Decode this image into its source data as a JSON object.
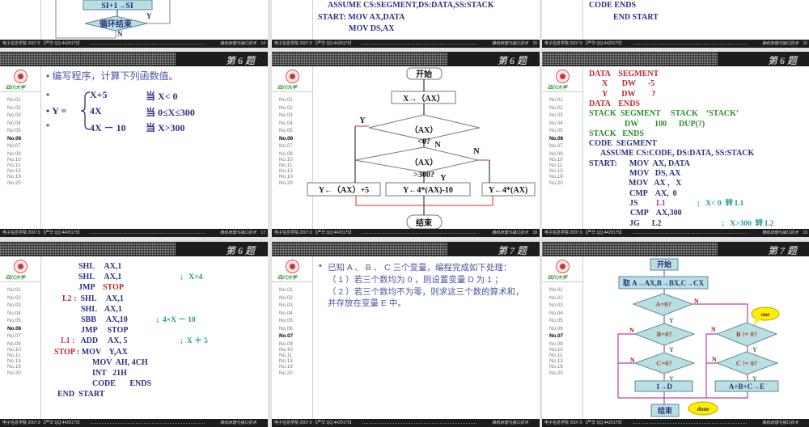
{
  "footer": {
    "left": "电子信息学院   2007.9 【严华  QQ:4429175】",
    "right": "微机原理与接口技术"
  },
  "logo_text": "四川大学",
  "nav": [
    "No.01",
    "No.02",
    "No.03",
    "No.04",
    "No.05",
    "No.06",
    "No.07",
    "No.09",
    "No.10",
    "No.11",
    "No.13",
    "No.19",
    "No.20"
  ],
  "colors": {
    "r": "#c0272d",
    "g": "#2e8b2e",
    "b": "#2b2f7f",
    "m": "#b03a9c",
    "t": "#1a9a9a",
    "accent_line": "#d0302a",
    "flow_line": "#c040a0",
    "flow_box": "#b9dfe2"
  },
  "slides": [
    {
      "page": "14",
      "flow": {
        "box": "SI+1→SI",
        "diamond": "循环结束",
        "y": "Y",
        "n": "N"
      }
    },
    {
      "page": "15",
      "code": [
        [
          [
            "ASSUME CS:SEGMENT,DS:DATA,SS:STACK",
            "b"
          ]
        ],
        [
          [
            "START: MOV AX,DATA",
            "b"
          ]
        ],
        [
          [
            "MOV DS,AX",
            "b"
          ]
        ]
      ]
    },
    {
      "page": "16",
      "code": [
        [
          [
            "CODE ENDS",
            "b"
          ]
        ],
        [
          [
            "END START",
            "b"
          ]
        ]
      ]
    },
    {
      "title": "第 6 题",
      "page": "17",
      "active": 5,
      "intro": "编写程序，计算下列函数值。",
      "y_label": "Y =",
      "cases": [
        {
          "expr": "X+5",
          "cond": "当 X< 0"
        },
        {
          "expr": "4X",
          "cond": "当 0≤X≤300"
        },
        {
          "expr": "4X － 10",
          "cond": "当 X>300"
        }
      ]
    },
    {
      "title": "第 6 题",
      "page": "18",
      "active": 5,
      "flow": {
        "start": "开始",
        "input": "X→（AX）",
        "c1a": "（AX）",
        "c1b": "<0?",
        "c2a": "（AX）",
        "c2b": ">300?",
        "box1": "Y←（AX）+5",
        "box2": "Y←4*(AX)-10",
        "box3": "Y←4*(AX)",
        "end": "结束",
        "y1": "Y",
        "n1": "N",
        "n2": "N",
        "y2": "Y"
      }
    },
    {
      "title": "第 6 题",
      "page": "19",
      "active": 5,
      "code": [
        [
          [
            "DATA    SEGMENT",
            "r"
          ]
        ],
        [
          [
            "X       DW      -5",
            "r"
          ]
        ],
        [
          [
            "Y       DW        ?",
            "r"
          ]
        ],
        [
          [
            "DATA    ENDS",
            "r"
          ]
        ],
        [
          [
            "STACK  SEGMENT     STACK    ‘STACK’",
            "g"
          ]
        ],
        [
          [
            "DW        100      DUP(?)",
            "g"
          ]
        ],
        [
          [
            "STACK   ENDS",
            "g"
          ]
        ],
        [
          [
            "CODE  SEGMENT",
            "b"
          ]
        ],
        [
          [
            "ASSUME CS:CODE, DS:DATA, SS:STACK",
            "b"
          ]
        ],
        [
          [
            "START:      MOV  AX, DATA",
            "b"
          ]
        ],
        [
          [
            "MOV   DS, AX",
            "b"
          ]
        ],
        [
          [
            "MOV   AX ,   X",
            "b"
          ]
        ],
        [
          [
            "CMP    AX,  0",
            "b"
          ]
        ],
        [
          [
            "JS         ",
            "b"
          ],
          [
            "L1",
            "m"
          ],
          [
            ";   X< 0  转 L1",
            "t"
          ]
        ],
        [
          [
            "CMP    AX,300",
            "b"
          ]
        ],
        [
          [
            "JG      L2",
            "b"
          ],
          [
            ";   X>300  转 L2",
            "t"
          ]
        ]
      ]
    },
    {
      "title": "第 6 题",
      "active": 5,
      "code": [
        [
          [
            "SHL     AX,1",
            "b"
          ]
        ],
        [
          [
            "SHL     AX,1",
            "b"
          ],
          [
            ";   X×4",
            "t"
          ]
        ],
        [
          [
            "JMP    ",
            "b"
          ],
          [
            "STOP",
            "r"
          ]
        ],
        [
          [
            "L2 :",
            "r"
          ],
          [
            "  SHL     AX,1",
            "b"
          ]
        ],
        [
          [
            "SHL    AX,1",
            "b"
          ]
        ],
        [
          [
            "SBB     AX,10",
            "b"
          ],
          [
            ";  4×X － 10",
            "t"
          ]
        ],
        [
          [
            "JMP     STOP",
            "b"
          ]
        ],
        [
          [
            "L1 :",
            "m"
          ],
          [
            "   ADD     AX, 5",
            "b"
          ],
          [
            ";  X ＋ 5",
            "t"
          ]
        ],
        [
          [
            "STOP",
            "r"
          ],
          [
            " : MOV    Y,AX",
            "b"
          ]
        ],
        [
          [
            "MOV  AH, 4CH",
            "b"
          ]
        ],
        [
          [
            "INT   21H",
            "b"
          ]
        ],
        [
          [
            "CODE       ENDS",
            "b"
          ]
        ],
        [
          [
            "END  START",
            "b"
          ]
        ]
      ]
    },
    {
      "title": "第 7 题",
      "active": 6,
      "lines": [
        "已知 A 、 B 、 C 三个变量，编程完成如下处理：",
        "（ 1 ）若三个数均为 0 ，则设置变量 D 为 1 ；",
        "（ 2 ）若三个数均不为零，则求这三个数的算术和，",
        "并存放在变量 E 中。"
      ]
    },
    {
      "title": "第 7 题",
      "active": 6,
      "flow": {
        "start": "开始",
        "load": "取 A→AX,B→BX,C→CX",
        "a0": "A=0?",
        "b0": "B=0?",
        "c0": "C=0?",
        "d": "1→D",
        "bn0": "B != 0?",
        "cn0": "C != 0?",
        "e": "A+B+C→E",
        "end": "结束",
        "one": "one",
        "done": "done",
        "y": "Y",
        "n": "N"
      }
    }
  ]
}
